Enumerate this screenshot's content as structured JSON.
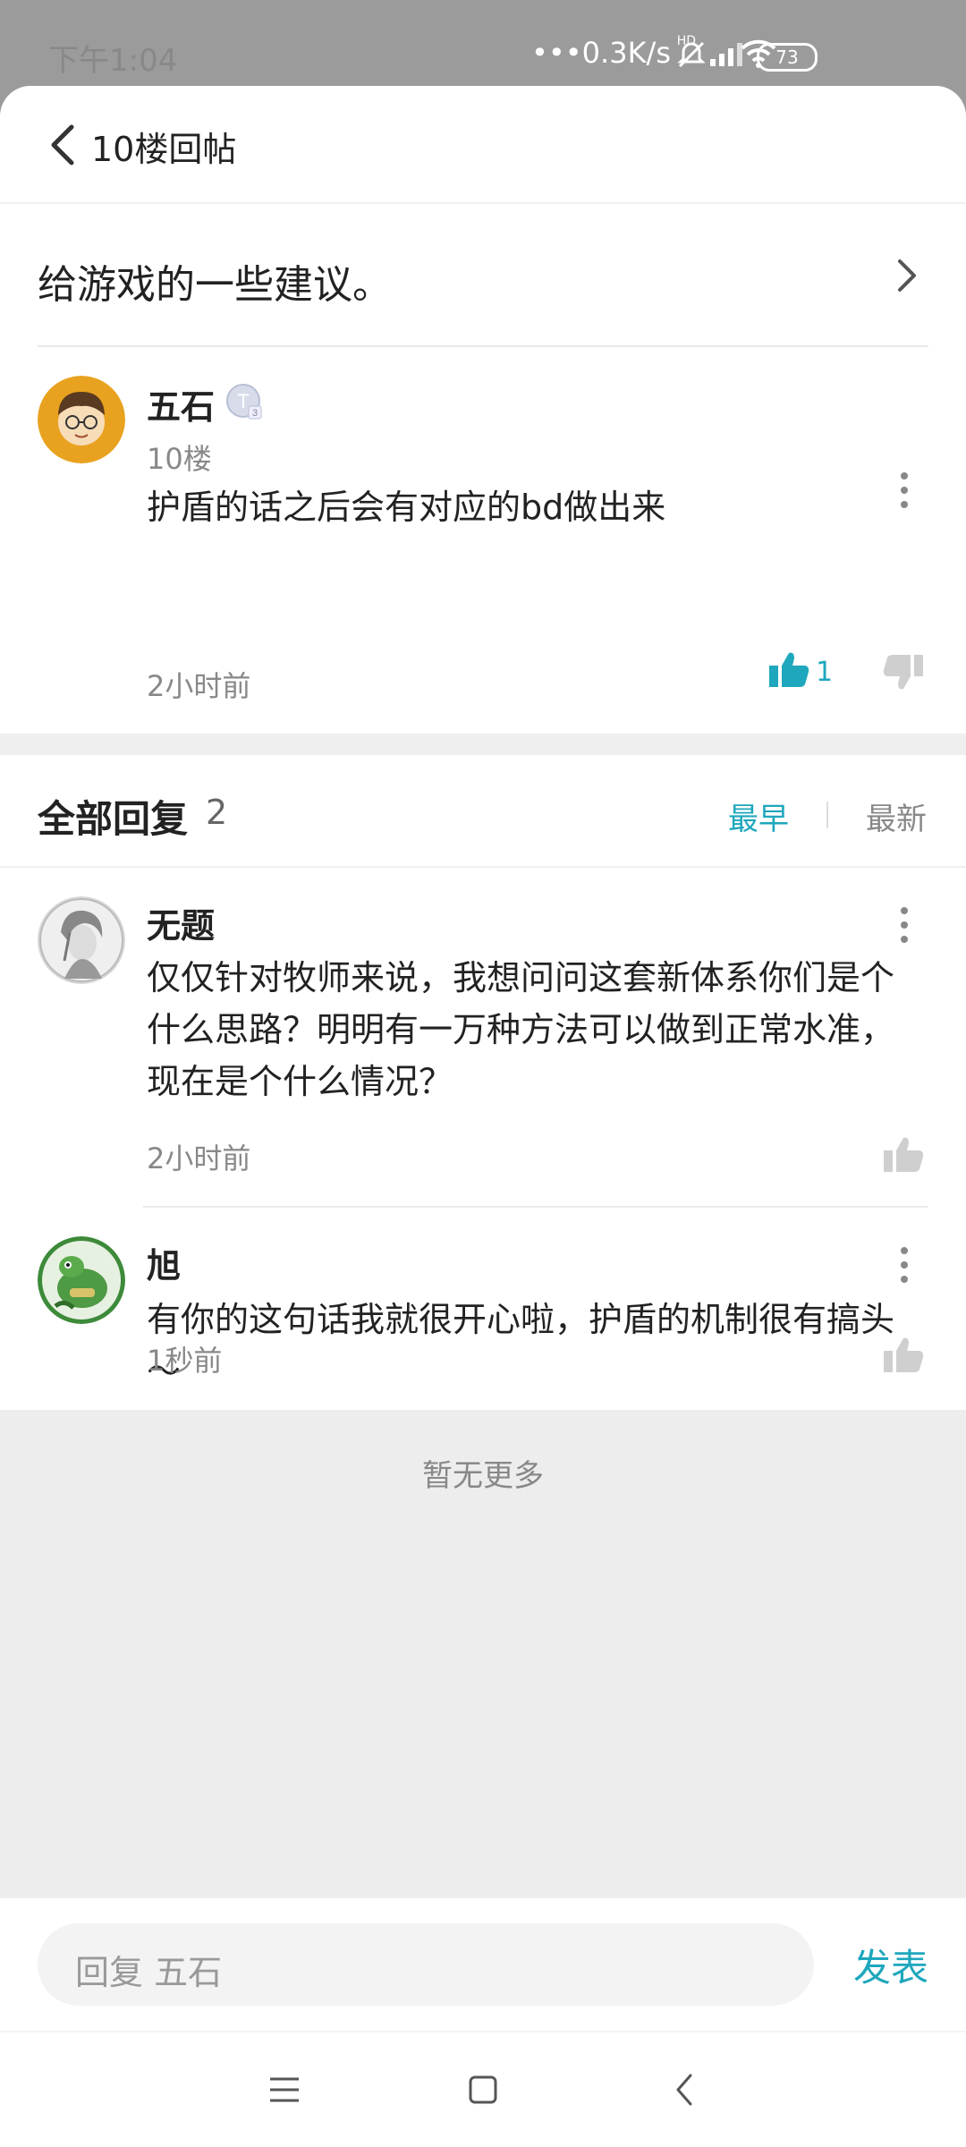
{
  "status_bar": {
    "time": "下午1:04",
    "speed": "•••0.3K/s",
    "battery": "73"
  },
  "header": {
    "back_icon": "chevron-left-icon",
    "title": "10楼回帖"
  },
  "thread": {
    "title": "给游戏的一些建议。",
    "chevron_icon": "chevron-right-icon"
  },
  "post": {
    "author": "五石",
    "badge": "T3",
    "floor": "10楼",
    "content": "护盾的话之后会有对应的bd做出来",
    "time": "2小时前",
    "likes": "1"
  },
  "replies": {
    "title": "全部回复",
    "count": "2",
    "sort_early": "最早",
    "sort_new": "最新",
    "items": [
      {
        "author": "无题",
        "content": "仅仅针对牧师来说，我想问问这套新体系你们是个什么思路？明明有一万种方法可以做到正常水准，现在是个什么情况？",
        "time": "2小时前"
      },
      {
        "author": "旭",
        "content": "有你的这句话我就很开心啦，护盾的机制很有搞头～",
        "time": "1秒前"
      }
    ]
  },
  "footer": {
    "no_more": "暂无更多"
  },
  "input": {
    "placeholder": "回复 五石",
    "send_label": "发表"
  },
  "colors": {
    "accent": "#1ea7bd",
    "status_bar": "#9b9b9b",
    "footer_bg": "#ededed"
  }
}
